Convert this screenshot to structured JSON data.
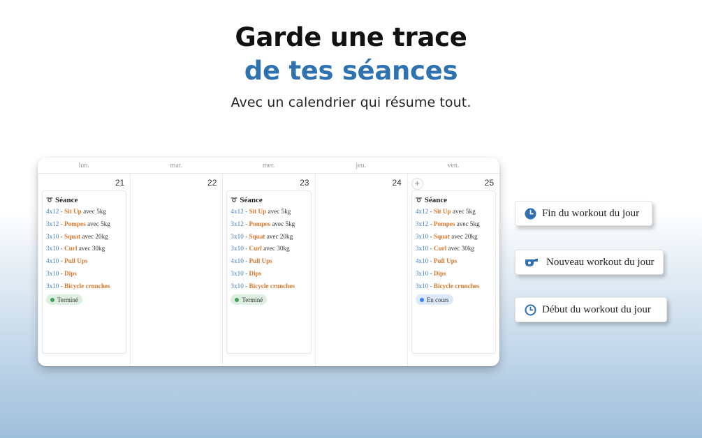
{
  "hero": {
    "title_line1": "Garde une trace",
    "title_line2": "de tes séances",
    "subtitle": "Avec un calendrier qui résume tout."
  },
  "calendar": {
    "weekdays": [
      "lun.",
      "mar.",
      "mer.",
      "jeu.",
      "ven."
    ],
    "dates": [
      "21",
      "22",
      "23",
      "24",
      "25"
    ],
    "card_title": "Séance",
    "exercises": [
      {
        "sets": "4x12",
        "name": "Sit Up",
        "extra": "avec 5kg"
      },
      {
        "sets": "3x12",
        "name": "Pompes",
        "extra": "avec 5kg"
      },
      {
        "sets": "3x10",
        "name": "Squat",
        "extra": "avec 20kg"
      },
      {
        "sets": "3x10",
        "name": "Curl",
        "extra": "avec 30kg"
      },
      {
        "sets": "4x10",
        "name": "Pull Ups",
        "extra": ""
      },
      {
        "sets": "3x10",
        "name": "Dips",
        "extra": ""
      },
      {
        "sets": "3x10",
        "name": "Bicycle crunches",
        "extra": ""
      }
    ],
    "status_done": "Terminé",
    "status_progress": "En cours",
    "add_label": "+"
  },
  "buttons": {
    "end": "Fin du workout du jour",
    "new": "Nouveau workout du jour",
    "start": "Début du workout du jour"
  },
  "colors": {
    "accent_blue": "#2f72b0",
    "sets_blue": "#3f7fc1",
    "exercise_orange": "#d9792f",
    "done_green": "#43a05a",
    "progress_blue": "#3b82f6"
  }
}
